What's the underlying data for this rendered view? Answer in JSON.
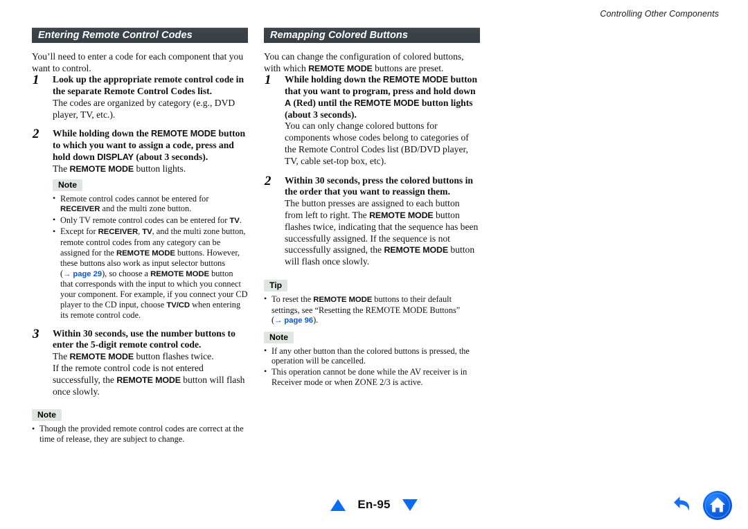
{
  "running_head": "Controlling Other Components",
  "left_column": {
    "section_title": "Entering Remote Control Codes",
    "intro": "You’ll need to enter a code for each component that you want to control.",
    "steps": [
      {
        "number": "1",
        "heading_parts": [
          {
            "t": "Look up the appropriate remote control code in the separate Remote Control Codes list.",
            "s": "b"
          }
        ],
        "body_parts": [
          {
            "t": "The codes are organized by category (e.g., DVD player, TV, etc.).",
            "s": "n"
          }
        ]
      },
      {
        "number": "2",
        "heading_parts": [
          {
            "t": "While holding down the ",
            "s": "b"
          },
          {
            "t": "REMOTE MODE",
            "s": "btn"
          },
          {
            "t": " button to which you want to assign a code, press and hold down ",
            "s": "b"
          },
          {
            "t": "DISPLAY",
            "s": "btn"
          },
          {
            "t": " (about 3 seconds).",
            "s": "b"
          }
        ],
        "body_parts": [
          {
            "t": "The ",
            "s": "n"
          },
          {
            "t": "REMOTE MODE",
            "s": "btn"
          },
          {
            "t": " button lights.",
            "s": "n"
          }
        ]
      },
      {
        "number": "3",
        "heading_parts": [
          {
            "t": "Within 30 seconds, use the number buttons to enter the 5-digit remote control code.",
            "s": "b"
          }
        ],
        "body_parts": [
          {
            "t": "The ",
            "s": "n"
          },
          {
            "t": "REMOTE MODE",
            "s": "btn"
          },
          {
            "t": " button flashes twice.",
            "s": "n"
          },
          {
            "t": "\n",
            "s": "br"
          },
          {
            "t": "If the remote control code is not entered successfully, the ",
            "s": "n"
          },
          {
            "t": "REMOTE MODE",
            "s": "btn"
          },
          {
            "t": " button will flash once slowly.",
            "s": "n"
          }
        ]
      }
    ],
    "note_inner": {
      "label": "Note",
      "bullets": [
        [
          {
            "t": "Remote control codes cannot be entered for ",
            "s": "n"
          },
          {
            "t": "RECEIVER",
            "s": "btn"
          },
          {
            "t": " and the multi zone button.",
            "s": "n"
          }
        ],
        [
          {
            "t": "Only TV remote control codes can be entered for ",
            "s": "n"
          },
          {
            "t": "TV",
            "s": "btn"
          },
          {
            "t": ".",
            "s": "n"
          }
        ],
        [
          {
            "t": "Except for ",
            "s": "n"
          },
          {
            "t": "RECEIVER",
            "s": "btn"
          },
          {
            "t": ", ",
            "s": "n"
          },
          {
            "t": "TV",
            "s": "btn"
          },
          {
            "t": ", and the multi zone button, remote control codes from any category can be assigned for the ",
            "s": "n"
          },
          {
            "t": "REMOTE MODE",
            "s": "btn"
          },
          {
            "t": " buttons. However, these buttons also work as input selector buttons (",
            "s": "n"
          },
          {
            "t": "→ page 29",
            "s": "lnk"
          },
          {
            "t": "), so choose a ",
            "s": "n"
          },
          {
            "t": "REMOTE MODE",
            "s": "btn"
          },
          {
            "t": " button that corresponds with the input to which you connect your component. For example, if you connect your CD player to the CD input, choose ",
            "s": "n"
          },
          {
            "t": "TV/CD",
            "s": "btn"
          },
          {
            "t": " when entering its remote control code.",
            "s": "n"
          }
        ]
      ]
    },
    "note_outer": {
      "label": "Note",
      "bullets": [
        [
          {
            "t": "Though the provided remote control codes are correct at the time of release, they are subject to change.",
            "s": "n"
          }
        ]
      ]
    }
  },
  "right_column": {
    "section_title": "Remapping Colored Buttons",
    "intro_parts": [
      {
        "t": "You can change the configuration of colored buttons, with which ",
        "s": "n"
      },
      {
        "t": "REMOTE MODE",
        "s": "btn"
      },
      {
        "t": " buttons are preset.",
        "s": "n"
      }
    ],
    "steps": [
      {
        "number": "1",
        "heading_parts": [
          {
            "t": "While holding down the ",
            "s": "b"
          },
          {
            "t": "REMOTE MODE",
            "s": "btn"
          },
          {
            "t": " button that you want to program, press and hold down ",
            "s": "b"
          },
          {
            "t": "A",
            "s": "btn"
          },
          {
            "t": " (Red) until the ",
            "s": "b"
          },
          {
            "t": "REMOTE MODE",
            "s": "btn"
          },
          {
            "t": " button lights (about 3 seconds).",
            "s": "b"
          }
        ],
        "body_parts": [
          {
            "t": "You can only change colored buttons for components whose codes belong to categories of the Remote Control Codes list (BD/DVD player, TV, cable set-top box, etc).",
            "s": "n"
          }
        ]
      },
      {
        "number": "2",
        "heading_parts": [
          {
            "t": "Within 30 seconds, press the colored buttons in the order that you want to reassign them.",
            "s": "b"
          }
        ],
        "body_parts": [
          {
            "t": "The button presses are assigned to each button from left to right. The ",
            "s": "n"
          },
          {
            "t": "REMOTE MODE",
            "s": "btn"
          },
          {
            "t": " button flashes twice, indicating that the sequence has been successfully assigned. If the sequence is not successfully assigned, the ",
            "s": "n"
          },
          {
            "t": "REMOTE MODE",
            "s": "btn"
          },
          {
            "t": " button will flash once slowly.",
            "s": "n"
          }
        ]
      }
    ],
    "tip": {
      "label": "Tip",
      "bullets": [
        [
          {
            "t": "To reset the ",
            "s": "n"
          },
          {
            "t": "REMOTE MODE",
            "s": "btn"
          },
          {
            "t": " buttons to their default settings, see “Resetting the REMOTE MODE Buttons” (",
            "s": "n"
          },
          {
            "t": "→ page 96",
            "s": "lnk"
          },
          {
            "t": ").",
            "s": "n"
          }
        ]
      ]
    },
    "note": {
      "label": "Note",
      "bullets": [
        [
          {
            "t": "If any other button than the colored buttons is pressed, the operation will be cancelled.",
            "s": "n"
          }
        ],
        [
          {
            "t": "This operation cannot be done while the AV receiver is in Receiver mode or when ZONE 2/3 is active.",
            "s": "n"
          }
        ]
      ]
    }
  },
  "footer": {
    "prev_label": "previous-page",
    "page": "En-95",
    "next_label": "next-page",
    "back_label": "back",
    "home_label": "home"
  },
  "colors": {
    "header_bar": "#3e464b",
    "badge_bg": "#dfe6e2",
    "link_blue": "#0b57d0",
    "nav_blue": "#0a6cf0"
  }
}
